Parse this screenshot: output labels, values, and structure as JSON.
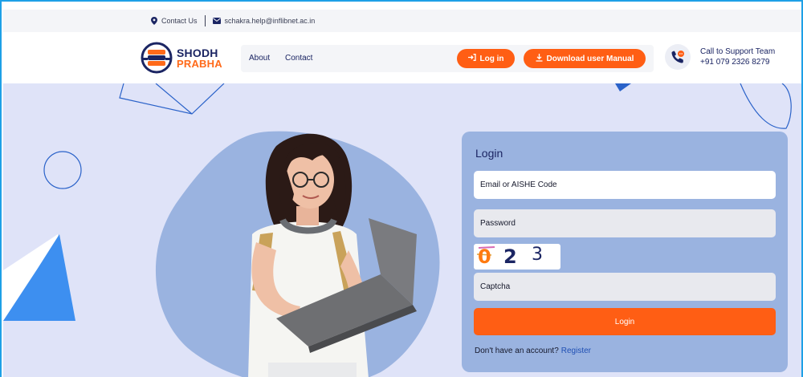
{
  "topbar": {
    "contact_label": "Contact Us",
    "email": "schakra.help@inflibnet.ac.in"
  },
  "logo": {
    "line1": "SHODH",
    "line2": "PRABHA"
  },
  "nav": {
    "about": "About",
    "contact": "Contact",
    "login_button": "Log in",
    "manual_button": "Download user Manual"
  },
  "support": {
    "title": "Call to Support Team",
    "phone": "+91 079 2326 8279"
  },
  "login": {
    "title": "Login",
    "email_placeholder": "Email or AISHE Code",
    "password_placeholder": "Password",
    "captcha_digits": [
      "0",
      "2",
      "3"
    ],
    "captcha_placeholder": "Captcha",
    "submit": "Login",
    "register_prompt": "Don't have an account?",
    "register_link": "Register"
  },
  "colors": {
    "accent": "#ff5e14",
    "navy": "#1b2563",
    "hero_bg": "#dfe3f8",
    "card_bg": "#9ab3e0",
    "frame": "#1ea0e6"
  },
  "icons": [
    "map-pin-icon",
    "mail-icon",
    "login-icon",
    "download-icon",
    "phone-icon"
  ]
}
